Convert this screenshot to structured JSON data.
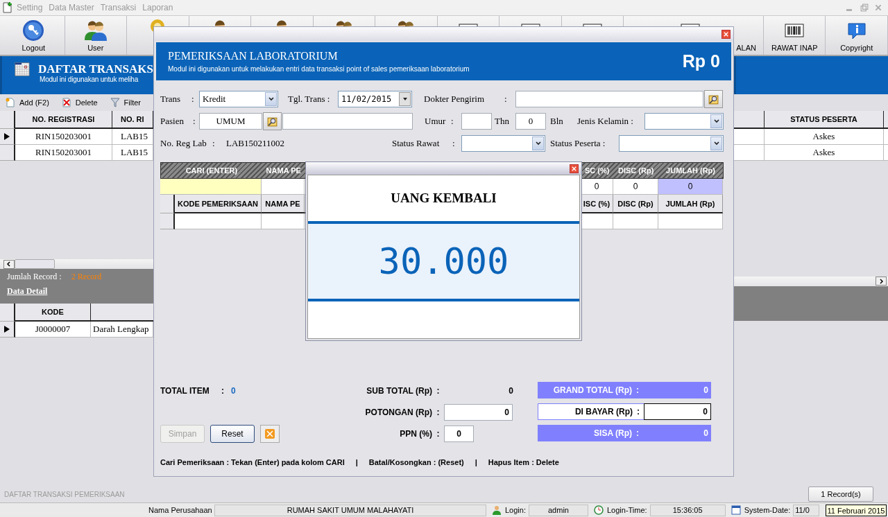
{
  "menu": [
    {
      "label": "Setting",
      "disabled": true
    },
    {
      "label": "Data Master",
      "disabled": true
    },
    {
      "label": "Transaksi",
      "disabled": true
    },
    {
      "label": "Laporan",
      "disabled": true
    }
  ],
  "toolbar": [
    {
      "kind": "logout",
      "label": "Logout"
    },
    {
      "kind": "users",
      "label": "User"
    },
    {
      "kind": "key"
    },
    {
      "kind": "person"
    },
    {
      "kind": "person"
    },
    {
      "kind": "users"
    },
    {
      "kind": "users"
    },
    {
      "kind": "barcode"
    },
    {
      "kind": "barcode"
    },
    {
      "kind": "barcode"
    },
    {
      "kind": "barcode",
      "label": "ALAN"
    },
    {
      "kind": "barcode",
      "label": "RAWAT INAP"
    },
    {
      "kind": "info",
      "label": "Copyright"
    }
  ],
  "main": {
    "title": "DAFTAR TRANSAKS",
    "subtitle": "Modul ini digunakan untuk meliha",
    "actions": [
      {
        "kind": "add",
        "label": "Add (F2)"
      },
      {
        "kind": "delete",
        "label": "Delete"
      },
      {
        "kind": "filter",
        "label": "Filter"
      }
    ],
    "columns": [
      "NO. REGISTRASI",
      "NO. RI"
    ],
    "right_column": "STATUS PESERTA",
    "rows": [
      {
        "selected": true,
        "cells": [
          "RIN150203001",
          "LAB15"
        ],
        "right": "Askes"
      },
      {
        "selected": false,
        "cells": [
          "RIN150203001",
          "LAB15"
        ],
        "right": "Askes"
      }
    ],
    "record_label": "Jumlah Record :",
    "record_count": "2 Record",
    "detail_link": "Data Detail",
    "detail_columns": [
      "KODE"
    ],
    "detail_rows": [
      {
        "selected": true,
        "cells": [
          "J0000007",
          "Darah Lengkap"
        ]
      }
    ],
    "footer_label": "DAFTAR TRANSAKSI PEMERIKSAAN",
    "record_button": "1 Record(s)"
  },
  "status_bar": {
    "company_label": "Nama Perusahaan",
    "company": "RUMAH SAKIT UMUM MALAHAYATI",
    "login_label": "Login:",
    "login": "admin",
    "time_label": "Login-Time:",
    "time": "15:36:05",
    "date_label": "System-Date:",
    "date": "11/0"
  },
  "dialog": {
    "title": "PEMERIKSAAN LABORATORIUM",
    "subtitle": "Modul ini digunakan untuk melakukan entri data transaksi point of sales pemeriksaan laboratorium",
    "total": "Rp 0",
    "trans": {
      "label": "Trans",
      "sep": ":",
      "value": "Kredit"
    },
    "date": {
      "label": "Tgl. Trans :",
      "value": "11/02/2015"
    },
    "doctor": {
      "label": "Dokter Pengirim",
      "sep": ":"
    },
    "patient": {
      "label": "Pasien",
      "sep": ":",
      "value": "UMUM"
    },
    "age": {
      "label": "Umur",
      "sep": ":",
      "years_label": "Thn",
      "months": "0",
      "months_label": "Bln"
    },
    "gender": {
      "label": "Jenis Kelamin :"
    },
    "reg": {
      "label": "No. Reg Lab",
      "sep": ":",
      "value": "LAB150211002"
    },
    "care": {
      "label": "Status Rawat",
      "sep": ":"
    },
    "member": {
      "label": "Status Peserta :"
    },
    "search_columns": [
      "CARI  (ENTER)",
      "NAMA PE",
      "SC (%)",
      "DISC (Rp)",
      "JUMLAH (Rp)"
    ],
    "search_row": [
      "0",
      "0",
      "0"
    ],
    "item_columns": [
      "KODE PEMERIKSAAN",
      "NAMA PE",
      "ISC (%)",
      "DISC (Rp)",
      "JUMLAH (Rp)"
    ],
    "total_item": {
      "label": "TOTAL ITEM",
      "sep": ":",
      "value": "0"
    },
    "subtotal": {
      "label": "SUB TOTAL (Rp)",
      "sep": ":",
      "value": "0"
    },
    "discount": {
      "label": "POTONGAN (Rp)",
      "sep": ":",
      "value": "0"
    },
    "ppn": {
      "label": "PPN (%)",
      "sep": ":",
      "value": "0"
    },
    "grand_total": {
      "label": "GRAND TOTAL (Rp)",
      "sep": ":",
      "value": "0"
    },
    "paid": {
      "label": "DI BAYAR (Rp)",
      "sep": ":",
      "value": "0"
    },
    "change": {
      "label": "SISA (Rp)",
      "sep": ":",
      "value": "0"
    },
    "buttons": [
      {
        "label": "Simpan",
        "disabled": true
      },
      {
        "label": "Reset",
        "disabled": false
      }
    ],
    "hints": [
      "Cari Pemeriksaan : Tekan (Enter) pada kolom CARI",
      "|",
      "Batal/Kosongkan : (Reset)",
      "|",
      "Hapus Item : Delete"
    ]
  },
  "change_dialog": {
    "title": "UANG KEMBALI",
    "amount": "30.000"
  },
  "tooltip": "11 Februari 2015"
}
